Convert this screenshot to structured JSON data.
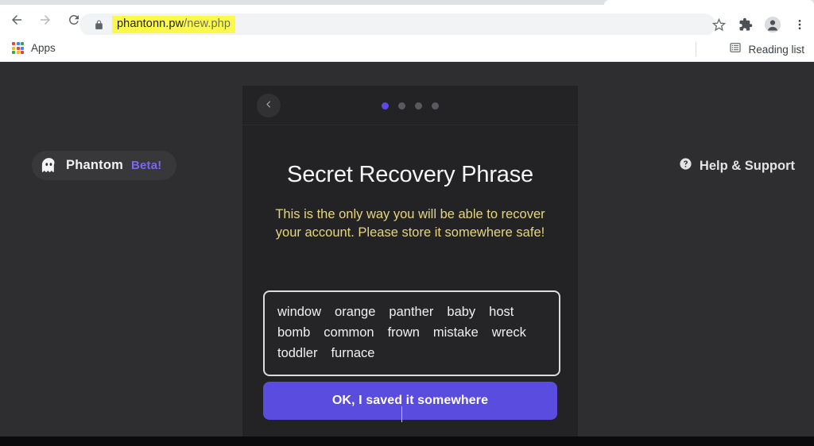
{
  "browser": {
    "nav": {
      "back_label": "Back",
      "forward_label": "Forward",
      "reload_label": "Reload"
    },
    "omnibox": {
      "lock_icon": "lock-icon",
      "url_host": "phantonn.pw",
      "url_path": "/new.php",
      "full_url": "phantonn.pw/new.php",
      "highlight_color": "#fcf94a"
    },
    "toolbar_icons": [
      {
        "name": "bookmark-star-icon",
        "label": "Bookmark this tab"
      },
      {
        "name": "extensions-puzzle-icon",
        "label": "Extensions"
      },
      {
        "name": "profile-avatar-icon",
        "label": "Profile"
      },
      {
        "name": "chrome-menu-icon",
        "label": "Customize and control Google Chrome"
      }
    ],
    "bookmarks_bar": {
      "apps_label": "Apps",
      "apps_icon": "apps-grid-icon",
      "reading_list_label": "Reading list",
      "reading_list_icon": "reading-list-icon"
    }
  },
  "page": {
    "brand": {
      "icon": "phantom-ghost-icon",
      "name": "Phantom",
      "beta": "Beta!",
      "beta_color": "#7b68ee"
    },
    "help": {
      "icon": "help-circle-icon",
      "label": "Help & Support"
    },
    "panel": {
      "back_icon": "chevron-left-icon",
      "steps": {
        "total": 4,
        "active_index": 0,
        "active_color": "#5b4be0",
        "inactive_color": "#5a5a5e"
      },
      "title": "Secret Recovery Phrase",
      "warning": "This is the only way you will be able to recover your account. Please store it somewhere safe!",
      "warning_color": "#e5d67d",
      "seed_phrase": [
        "window",
        "orange",
        "panther",
        "baby",
        "host",
        "bomb",
        "common",
        "frown",
        "mistake",
        "wreck",
        "toddler",
        "furnace"
      ],
      "cta_label": "OK, I saved it somewhere",
      "cta_color": "#5b4ce0"
    }
  }
}
